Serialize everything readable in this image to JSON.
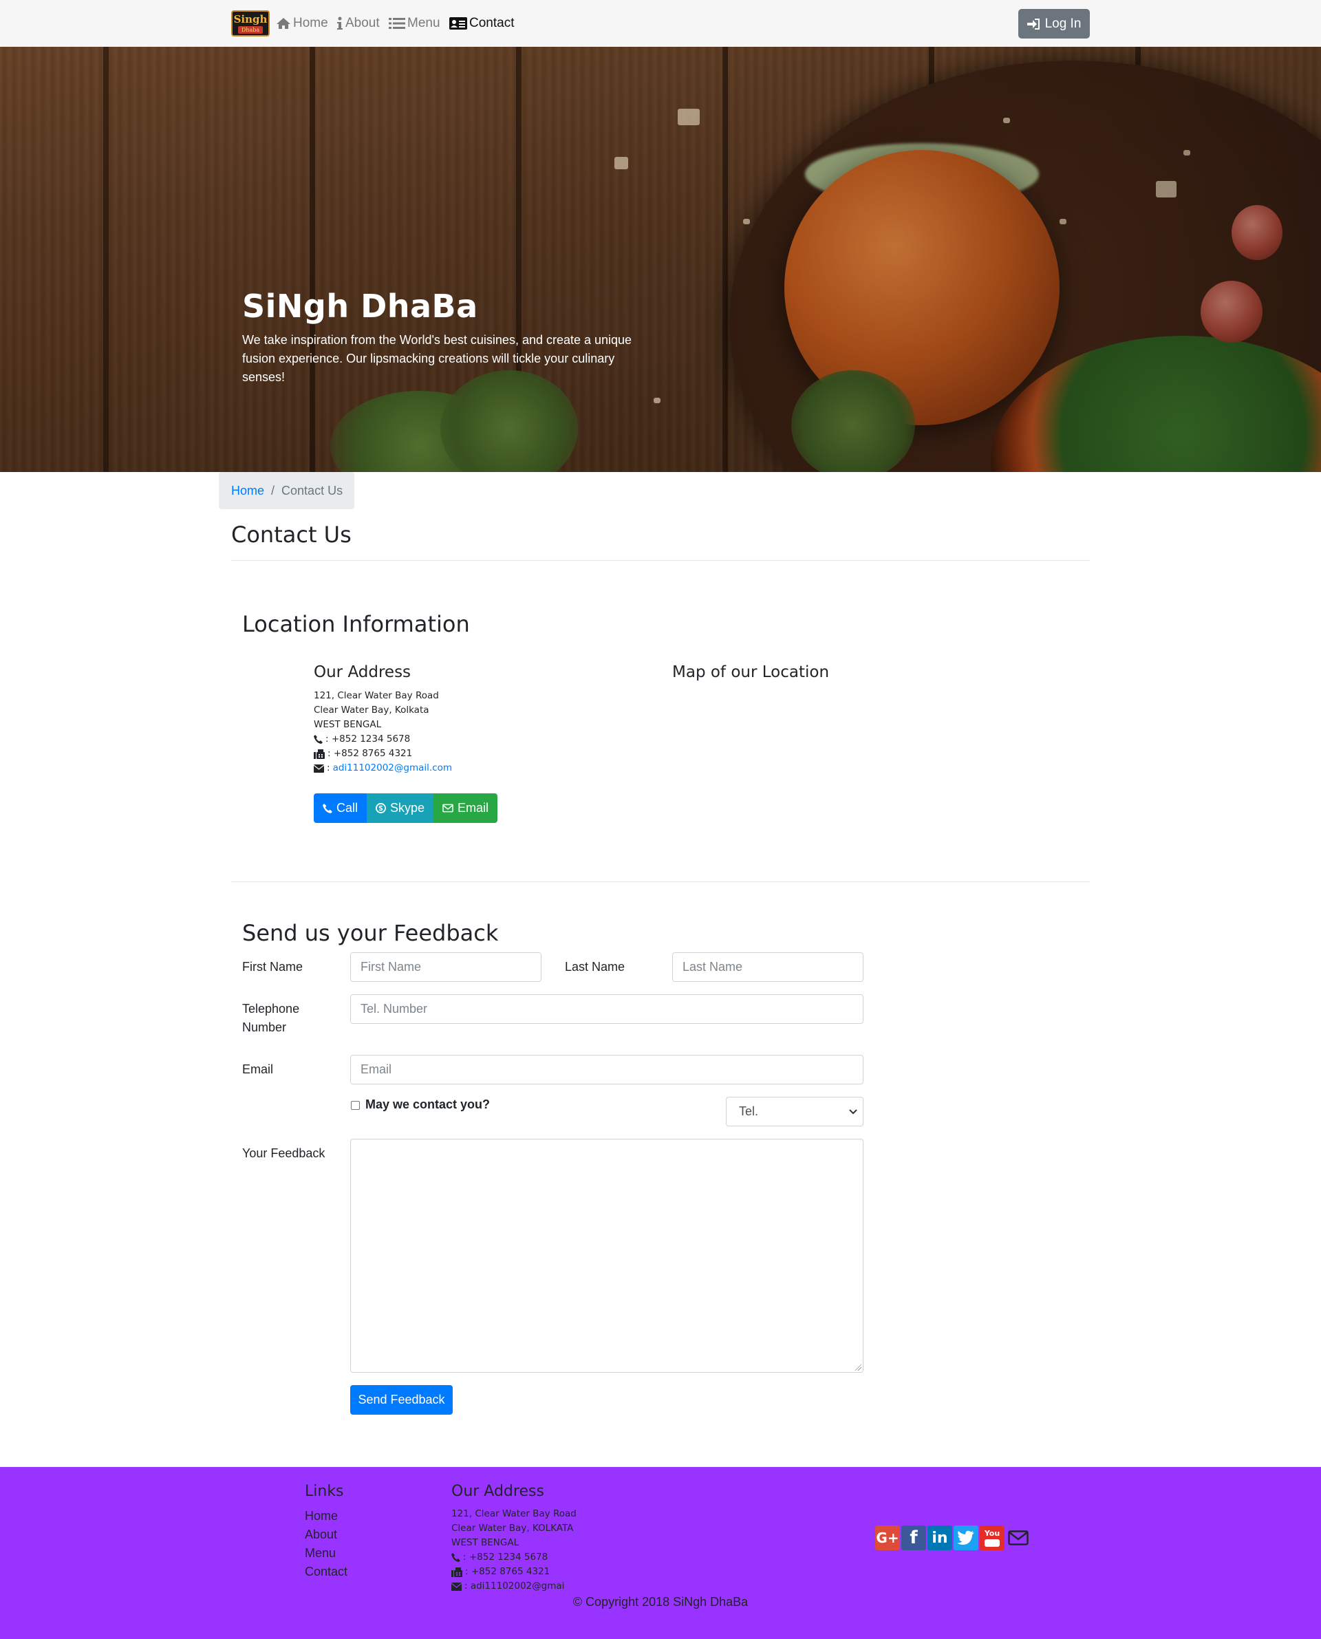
{
  "nav": {
    "logo_line1": "Singh",
    "logo_line2": "Dhaba",
    "items": [
      {
        "label": "Home"
      },
      {
        "label": "About"
      },
      {
        "label": "Menu"
      },
      {
        "label": "Contact"
      }
    ],
    "login_label": "Log In"
  },
  "hero": {
    "title": "SiNgh DhaBa",
    "text": "We take inspiration from the World's best cuisines, and create a unique fusion experience. Our lipsmacking creations will tickle your culinary senses!"
  },
  "breadcrumb": {
    "home": "Home",
    "separator": "/",
    "current": "Contact Us"
  },
  "page_title": "Contact Us",
  "location": {
    "title": "Location Information",
    "address_title": "Our Address",
    "address_lines": [
      "121, Clear Water Bay Road",
      "Clear Water Bay, Kolkata",
      "WEST BENGAL"
    ],
    "phone": ": +852 1234 5678",
    "fax": ": +852 8765 4321",
    "email_prefix": ":",
    "email": "adi11102002@gmail.com",
    "map_title": "Map of our Location",
    "buttons": {
      "call": "Call",
      "skype": "Skype",
      "email": "Email"
    }
  },
  "feedback": {
    "title": "Send us your Feedback",
    "first_name_label": "First Name",
    "first_name_placeholder": "First Name",
    "last_name_label": "Last Name",
    "last_name_placeholder": "Last Name",
    "tel_label_1": "Telephone",
    "tel_label_2": "Number",
    "tel_placeholder": "Tel. Number",
    "email_label": "Email",
    "email_placeholder": "Email",
    "contact_label": "May we contact you?",
    "contact_method": "Tel.",
    "feedback_label": "Your Feedback",
    "send_label": "Send Feedback"
  },
  "footer": {
    "links_title": "Links",
    "links": [
      "Home",
      "About",
      "Menu",
      "Contact"
    ],
    "address_title": "Our Address",
    "address_lines": [
      "121, Clear Water Bay Road",
      "Clear Water Bay, KOLKATA",
      "WEST BENGAL"
    ],
    "phone": ": +852 1234 5678",
    "fax": ": +852 8765 4321",
    "email": ": adi11102002@gmai",
    "social": [
      {
        "icon": "google-plus-icon",
        "label": "G+",
        "color": "#dd4b39"
      },
      {
        "icon": "facebook-icon",
        "label": "f",
        "color": "#3b5998"
      },
      {
        "icon": "linkedin-icon",
        "label": "in",
        "color": "#0077b5"
      },
      {
        "icon": "twitter-icon",
        "label": "t",
        "color": "#1da1f2"
      },
      {
        "icon": "youtube-icon",
        "label": "You",
        "color": "#e52d27"
      },
      {
        "icon": "mail-icon",
        "label": "",
        "color": "#212529"
      }
    ],
    "copyright": "© Copyright 2018 SiNgh DhaBa"
  },
  "colors": {
    "primary": "#007bff",
    "info": "#17a2b8",
    "success": "#28a745",
    "secondary": "#6c757d",
    "footer_bg": "#9933ff"
  }
}
